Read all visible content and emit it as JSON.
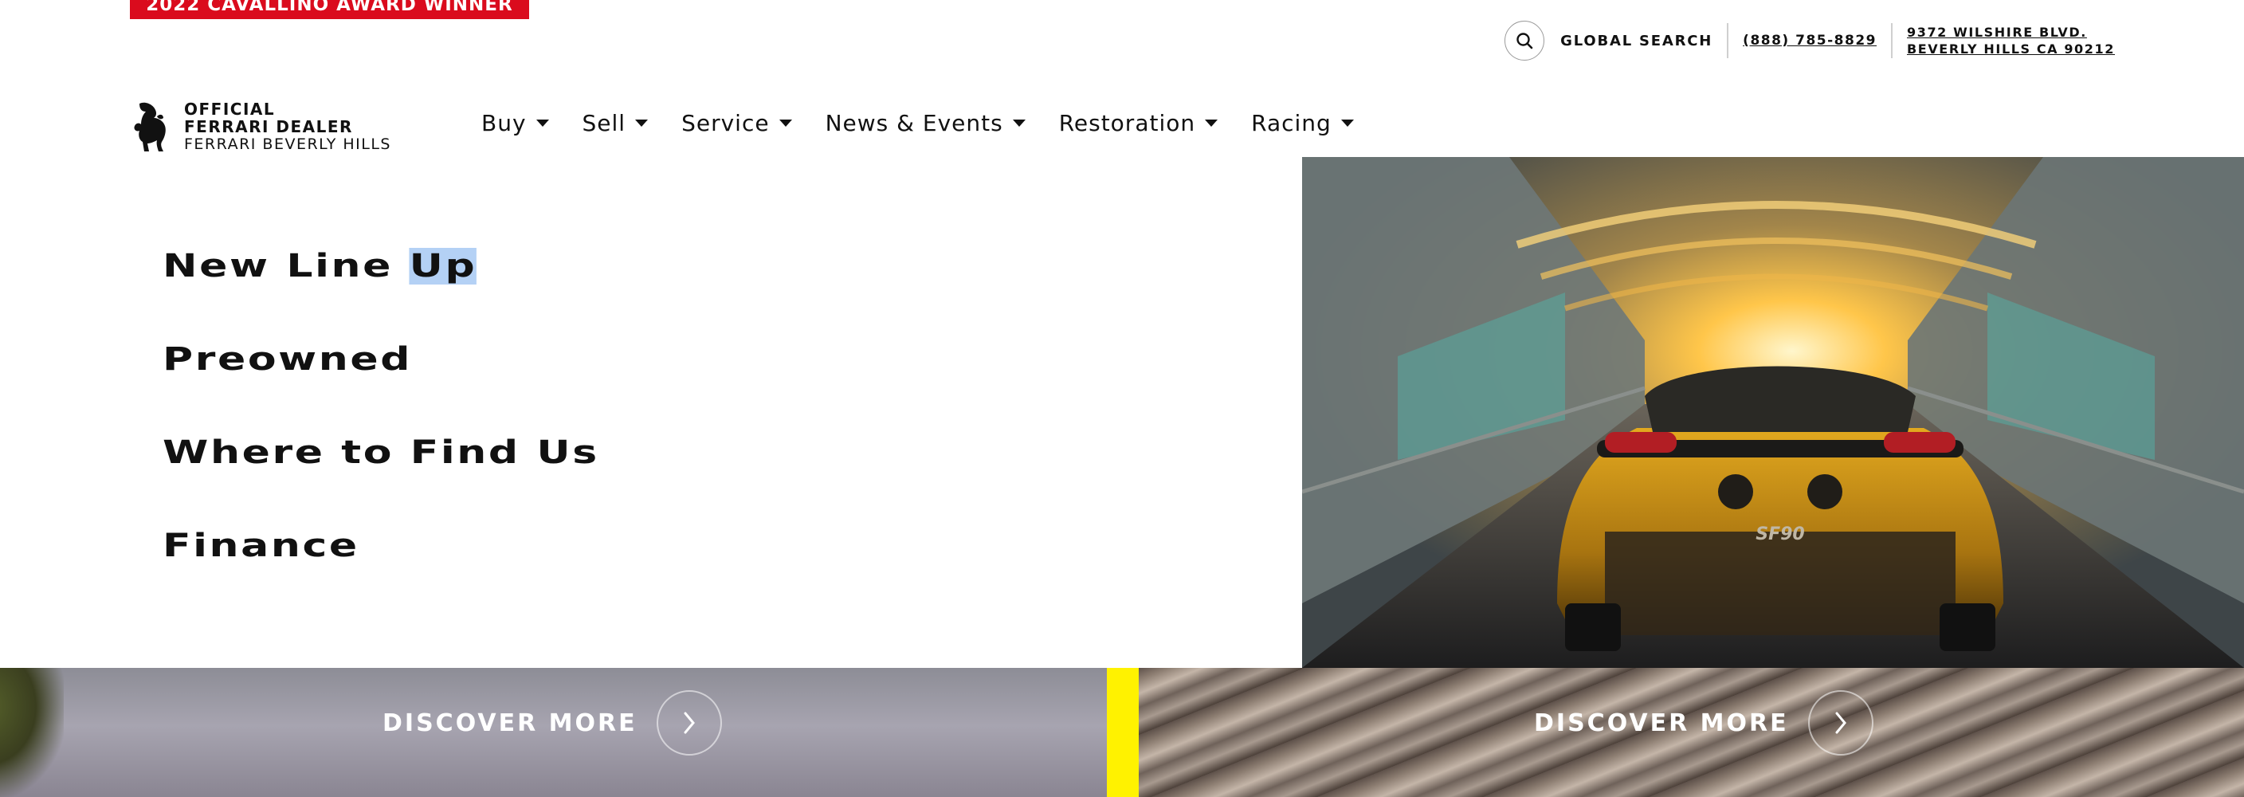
{
  "award_banner": "2022 CAVALLINO AWARD WINNER",
  "utility": {
    "search_label": "GLOBAL SEARCH",
    "phone": "(888) 785-8829",
    "address_line1": "9372 WILSHIRE BLVD.",
    "address_line2": "BEVERLY HILLS CA 90212"
  },
  "brand": {
    "line1": "OFFICIAL",
    "line2": "FERRARI DEALER",
    "line3": "FERRARI BEVERLY HILLS",
    "logo_icon": "prancing-horse-icon"
  },
  "nav": {
    "items": [
      {
        "label": "Buy"
      },
      {
        "label": "Sell"
      },
      {
        "label": "Service"
      },
      {
        "label": "News & Events"
      },
      {
        "label": "Restoration"
      },
      {
        "label": "Racing"
      }
    ]
  },
  "dropdown": {
    "links": [
      {
        "label": "New Line ",
        "highlight": "Up"
      },
      {
        "label": "Preowned"
      },
      {
        "label": "Where to Find Us"
      },
      {
        "label": "Finance"
      }
    ]
  },
  "hero": {
    "plate_text": "SF90"
  },
  "bands": {
    "left": {
      "cta": "DISCOVER MORE"
    },
    "right": {
      "cta": "DISCOVER MORE"
    }
  },
  "colors": {
    "award_red": "#da0b1d",
    "accent_yellow": "#fff200",
    "selection_highlight": "#b4d1f5"
  }
}
